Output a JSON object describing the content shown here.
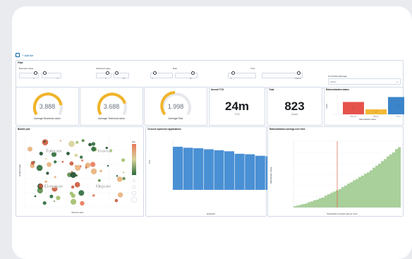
{
  "toolbar": {
    "add_panel_label": "+ add tile"
  },
  "filter": {
    "title": "Filter",
    "controls": [
      {
        "label": "Business value",
        "min": "0",
        "max": "5"
      },
      {
        "label": "Technical value",
        "min": "0",
        "max": "10"
      },
      {
        "label": "Risk",
        "min": "0",
        "max": "10"
      },
      {
        "label": "TCO",
        "min": "0",
        "max": "100000"
      },
      {
        "label": "IT Portfolio Manager",
        "value": "Select..."
      }
    ]
  },
  "kpis": {
    "business_value": {
      "value": "3.888",
      "label": "Average Business value",
      "fraction": 0.78
    },
    "technical_value": {
      "value": "3.688",
      "label": "Average Technical value",
      "fraction": 0.74
    },
    "risk": {
      "value": "1.998",
      "label": "Average Risk",
      "fraction": 0.4
    },
    "annual_tco": {
      "title": "Annual TCO",
      "value": "24m",
      "sub": "TCO"
    },
    "total": {
      "title": "Total",
      "value": "823",
      "sub": "Count"
    }
  },
  "colors": {
    "gauge": "#f0b429",
    "gauge_track": "#e6e8ec",
    "bar_blue": "#4a90d4",
    "area_green": "#a9cf9a",
    "marker_red": "#e06040"
  },
  "rationalization_status": {
    "title": "Rationalization status",
    "xlabel": "Rationalization status",
    "ylabel": "Count",
    "bars": [
      {
        "label": "Eliminate",
        "value": 5,
        "color": "#e5534b"
      },
      {
        "label": "Migrate",
        "value": 2,
        "color": "#f2b935"
      },
      {
        "label": "Invest",
        "value": 7,
        "color": "#3b84c9"
      }
    ]
  },
  "bubble": {
    "title": "Bubble plot",
    "xlabel": "Business value",
    "ylabel": "Technical value",
    "quadrants": [
      "Tolerate",
      "Invest",
      "Eliminate",
      "Migrate"
    ],
    "legend_title": "Risk"
  },
  "expensive_apps": {
    "title": "10 most expensive applications",
    "xlabel": "Application",
    "ylabel": "TCO"
  },
  "savings": {
    "title": "Rationalization savings over time",
    "xlabel": "Rationalization completion date per month",
    "ylabel": "Rationalization savings"
  },
  "chart_data": [
    {
      "type": "bar",
      "title": "10 most expensive applications",
      "categories": [
        "A1",
        "A2",
        "A3",
        "A4",
        "A5",
        "A6",
        "A7",
        "A8",
        "A9",
        "A10"
      ],
      "values": [
        86,
        84,
        83,
        81,
        79,
        77,
        72,
        71,
        68,
        67
      ],
      "ylim": [
        0,
        100
      ],
      "xlabel": "Application",
      "ylabel": "TCO"
    },
    {
      "type": "area",
      "title": "Rationalization savings over time",
      "values": [
        2,
        3,
        4,
        5,
        6,
        8,
        9,
        11,
        12,
        14,
        15,
        18,
        20,
        22,
        24,
        26,
        28,
        31,
        33,
        36,
        38,
        41,
        43,
        46,
        48,
        51,
        53,
        56,
        60,
        63,
        66,
        70,
        73,
        77,
        80,
        83,
        88,
        91,
        93
      ],
      "ylim": [
        0,
        100
      ]
    },
    {
      "type": "scatter",
      "title": "Bubble plot",
      "xlabel": "Business value",
      "ylabel": "Technical value",
      "xlim": [
        0,
        5
      ],
      "ylim": [
        0,
        5
      ]
    }
  ]
}
